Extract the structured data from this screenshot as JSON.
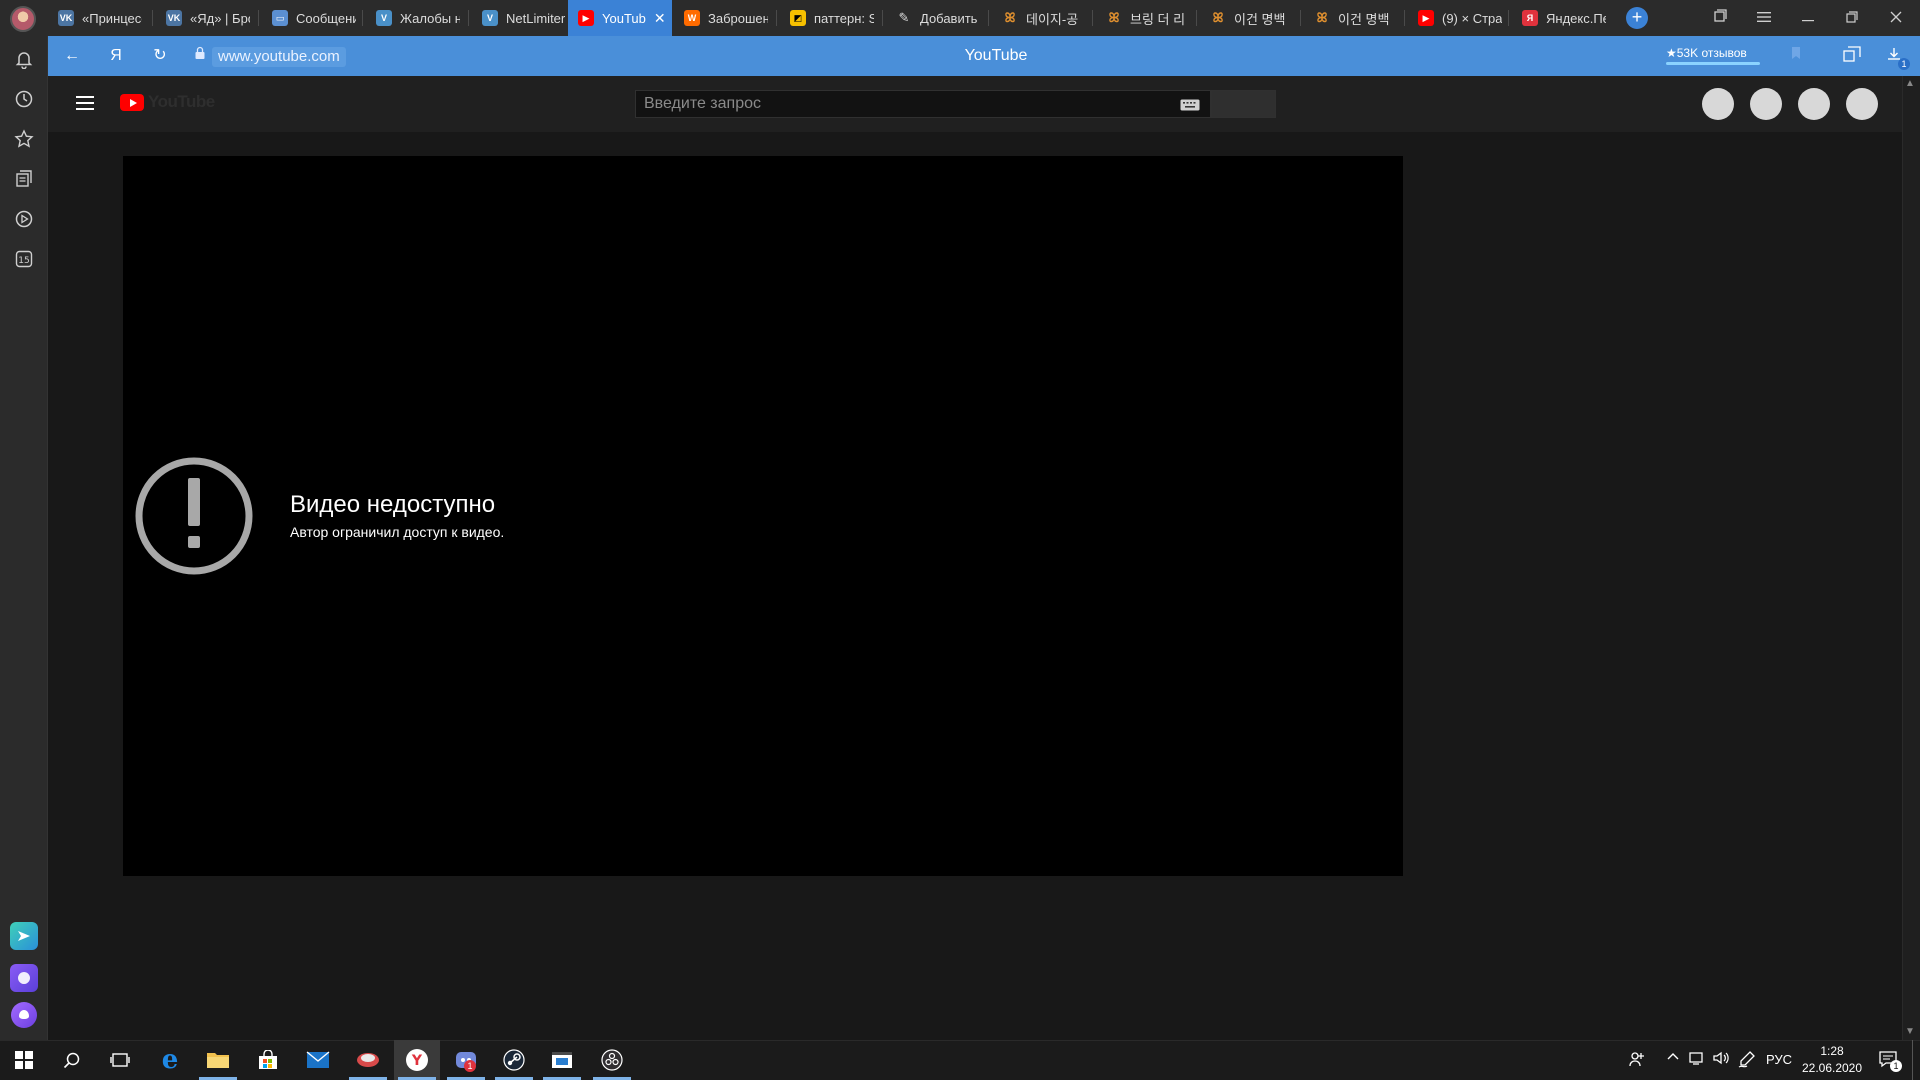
{
  "browser": {
    "tabs": [
      {
        "label": "«Принцесс",
        "icon": "vk-icon",
        "color": "#4c75a3"
      },
      {
        "label": "«Яд» | Бро",
        "icon": "vk-icon",
        "color": "#4c75a3"
      },
      {
        "label": "Сообщения",
        "icon": "message-icon",
        "color": "#5b8fd1"
      },
      {
        "label": "Жалобы н",
        "icon": "vivaldi-icon",
        "color": "#4a90c8"
      },
      {
        "label": "NetLimiter",
        "icon": "vivaldi-icon",
        "color": "#4a90c8"
      },
      {
        "label": "YouTub",
        "icon": "youtube-icon",
        "color": "#ff0000",
        "active": true
      },
      {
        "label": "Заброшен",
        "icon": "w-icon",
        "color": "#ff6b00"
      },
      {
        "label": "паттерн: S",
        "icon": "image-icon",
        "color": "#f7c000"
      },
      {
        "label": "Добавить",
        "icon": "pen-icon",
        "color": "#dddddd"
      },
      {
        "label": "데이지-공",
        "icon": "note-icon",
        "color": "#e0902f"
      },
      {
        "label": "브링 더 리",
        "icon": "note-icon",
        "color": "#e0902f"
      },
      {
        "label": "이건 명백",
        "icon": "note-icon",
        "color": "#e0902f"
      },
      {
        "label": "이건 명백",
        "icon": "note-icon",
        "color": "#e0902f"
      },
      {
        "label": "(9) × Стра",
        "icon": "youtube-icon",
        "color": "#ff0000"
      },
      {
        "label": "Яндекс.Пе",
        "icon": "yandex-icon",
        "color": "#e0323d"
      }
    ],
    "active_tab_close": "✕",
    "new_tab": "+",
    "address": {
      "back": "←",
      "yandex": "Я",
      "reload": "↻",
      "url": "www.youtube.com",
      "title": "YouTube",
      "reviews": "★53K отзывов"
    },
    "accent_color": "#3b82d6"
  },
  "youtube": {
    "logo_text": "YouTube",
    "search_placeholder": "Введите запрос",
    "error": {
      "title": "Видео недоступно",
      "subtitle": "Автор ограничил доступ к видео."
    }
  },
  "taskbar": {
    "language": "РУС",
    "time": "1:28",
    "date": "22.06.2020",
    "notifications": "1"
  }
}
